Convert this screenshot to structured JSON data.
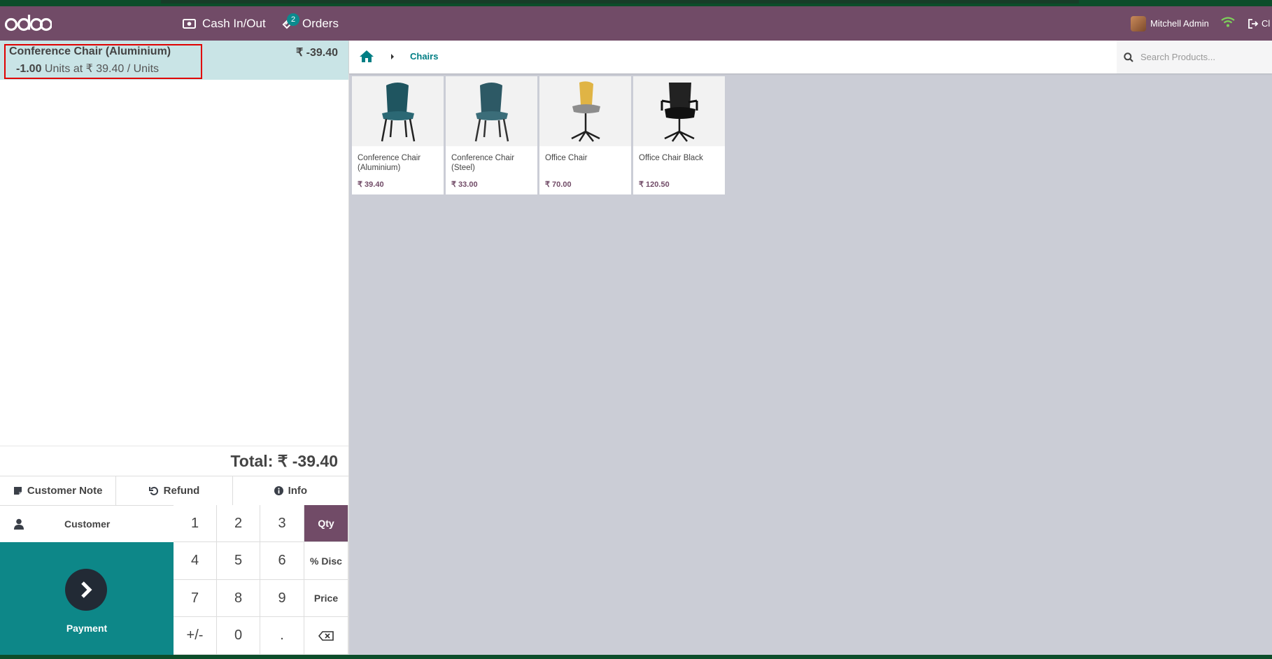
{
  "topbar": {
    "logo": "odoo",
    "cash_in_out": "Cash In/Out",
    "orders_label": "Orders",
    "orders_count": "2",
    "user_name": "Mitchell Admin",
    "close_label": "Cl"
  },
  "order": {
    "line": {
      "product": "Conference Chair (Aluminium)",
      "price": "₹ -39.40",
      "qty": "-1.00",
      "info": " Units at ₹ 39.40 / Units"
    },
    "total": "Total: ₹ -39.40"
  },
  "actions": {
    "customer_note": "Customer Note",
    "refund": "Refund",
    "info": "Info"
  },
  "customer_label": "Customer",
  "payment_label": "Payment",
  "numpad": {
    "k1": "1",
    "k2": "2",
    "k3": "3",
    "qty": "Qty",
    "k4": "4",
    "k5": "5",
    "k6": "6",
    "disc": "% Disc",
    "k7": "7",
    "k8": "8",
    "k9": "9",
    "price": "Price",
    "plusminus": "+/-",
    "k0": "0",
    "dot": "."
  },
  "breadcrumb": {
    "category": "Chairs"
  },
  "search": {
    "placeholder": "Search Products..."
  },
  "products": [
    {
      "name": "Conference Chair (Aluminium)",
      "price": "₹ 39.40"
    },
    {
      "name": "Conference Chair (Steel)",
      "price": "₹ 33.00"
    },
    {
      "name": "Office Chair",
      "price": "₹ 70.00"
    },
    {
      "name": "Office Chair Black",
      "price": "₹ 120.50"
    }
  ],
  "colors": {
    "brand": "#714b67",
    "accent": "#0d8788",
    "selected_line": "#c9e4e6",
    "highlight": "#e00000"
  }
}
